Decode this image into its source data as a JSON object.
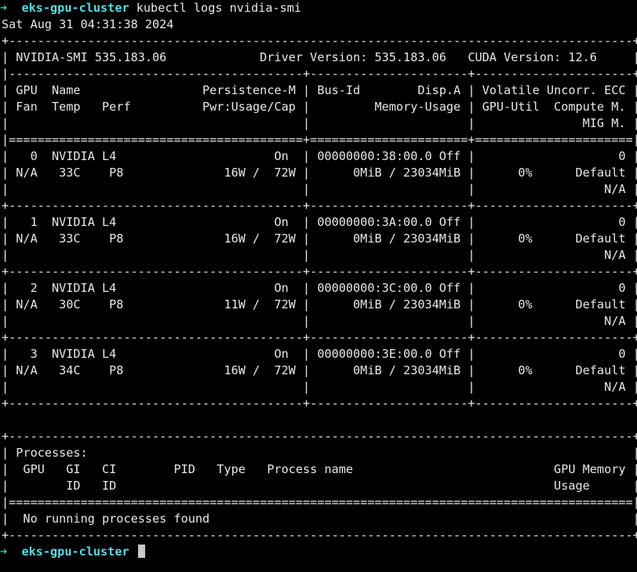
{
  "session": {
    "prompt_arrow": "➜",
    "cluster_name": "eks-gpu-cluster",
    "command": "kubectl logs nvidia-smi"
  },
  "output": {
    "lines": [
      "Sat Aug 31 04:31:38 2024",
      "+---------------------------------------------------------------------------------------+",
      "| NVIDIA-SMI 535.183.06             Driver Version: 535.183.06   CUDA Version: 12.6     |",
      "|-----------------------------------------+----------------------+----------------------+",
      "| GPU  Name                 Persistence-M | Bus-Id        Disp.A | Volatile Uncorr. ECC |",
      "| Fan  Temp   Perf          Pwr:Usage/Cap |         Memory-Usage | GPU-Util  Compute M. |",
      "|                                         |                      |               MIG M. |",
      "|=========================================+======================+======================|",
      "|   0  NVIDIA L4                      On  | 00000000:38:00.0 Off |                    0 |",
      "| N/A   33C    P8              16W /  72W |      0MiB / 23034MiB |      0%      Default |",
      "|                                         |                      |                  N/A |",
      "+-----------------------------------------+----------------------+----------------------+",
      "|   1  NVIDIA L4                      On  | 00000000:3A:00.0 Off |                    0 |",
      "| N/A   33C    P8              16W /  72W |      0MiB / 23034MiB |      0%      Default |",
      "|                                         |                      |                  N/A |",
      "+-----------------------------------------+----------------------+----------------------+",
      "|   2  NVIDIA L4                      On  | 00000000:3C:00.0 Off |                    0 |",
      "| N/A   30C    P8              11W /  72W |      0MiB / 23034MiB |      0%      Default |",
      "|                                         |                      |                  N/A |",
      "+-----------------------------------------+----------------------+----------------------+",
      "|   3  NVIDIA L4                      On  | 00000000:3E:00.0 Off |                    0 |",
      "| N/A   34C    P8              16W /  72W |      0MiB / 23034MiB |      0%      Default |",
      "|                                         |                      |                  N/A |",
      "+-----------------------------------------+----------------------+----------------------+",
      "",
      "+---------------------------------------------------------------------------------------+",
      "| Processes:                                                                            |",
      "|  GPU   GI   CI        PID   Type   Process name                            GPU Memory |",
      "|        ID   ID                                                             Usage      |",
      "|=======================================================================================|",
      "|  No running processes found                                                           |",
      "+---------------------------------------------------------------------------------------+"
    ]
  },
  "colors": {
    "background": "#000000",
    "text": "#e8e8e8",
    "prompt_arrow": "#3fd37e",
    "cluster_name": "#5ad9e6",
    "cursor": "#c9c9c9"
  }
}
